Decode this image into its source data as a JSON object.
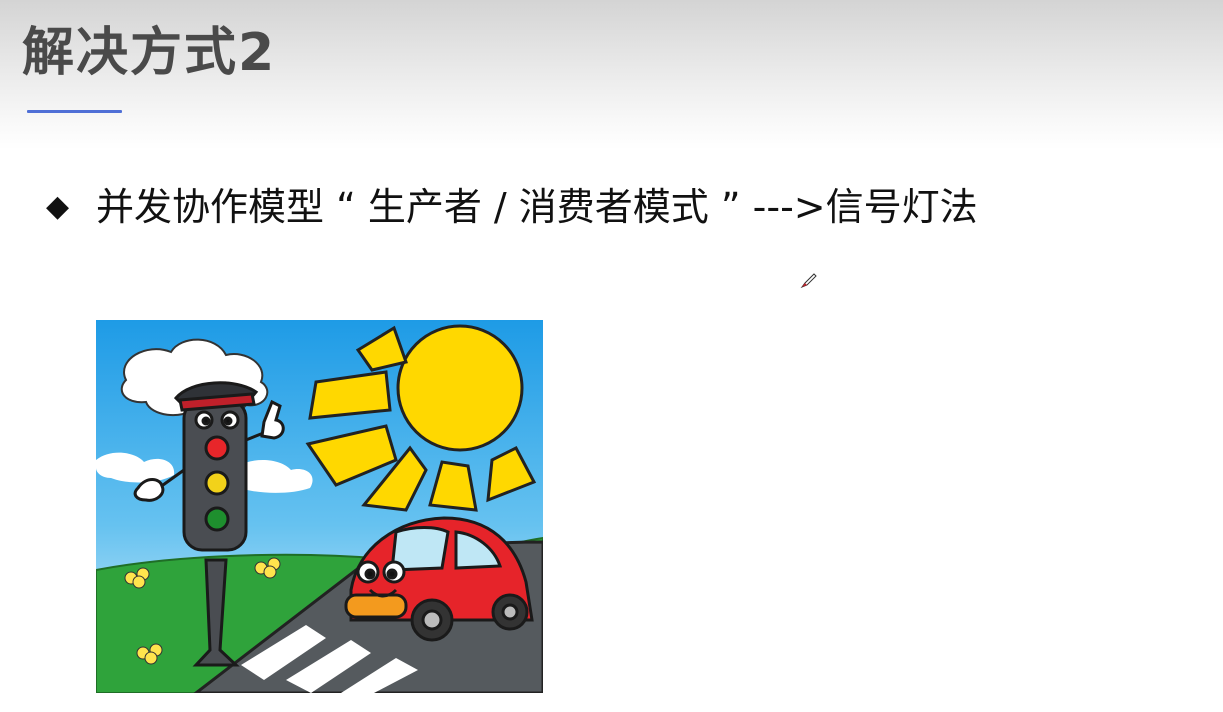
{
  "slide": {
    "title": "解决方式2",
    "bullet_text": "并发协作模型 “ 生产者 / 消费者模式 ” --->信号灯法"
  },
  "icons": {
    "bullet": "diamond-bullet-icon",
    "cursor": "pen-cursor-icon"
  },
  "colors": {
    "title_text": "#4a4a4a",
    "underline_accent": "#4f6fd6",
    "body_text": "#111111"
  }
}
